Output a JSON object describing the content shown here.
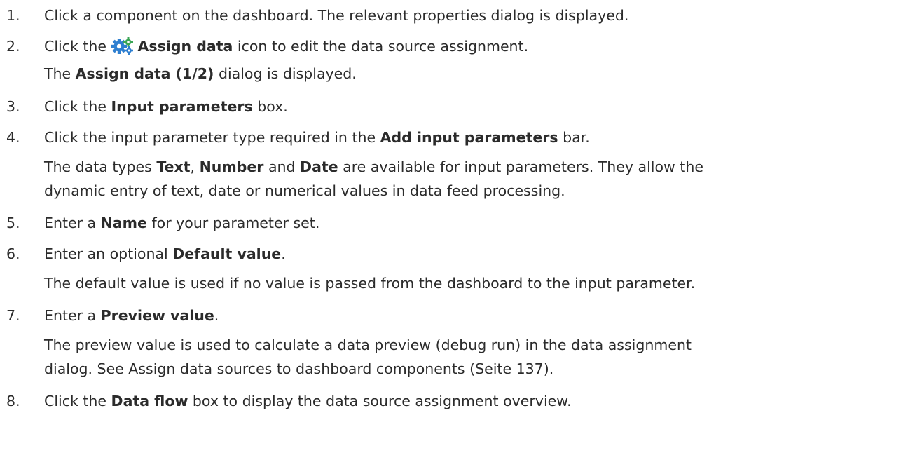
{
  "steps": [
    {
      "num": "1.",
      "text": "Click a component on the dashboard. The relevant properties dialog is displayed."
    },
    {
      "num": "2.",
      "pre": "Click the",
      "icon": "gear-icon",
      "bold": "Assign data",
      "post": "icon to edit the data source assignment.",
      "note": {
        "bold": "Assign data (1/2)",
        "post": "dialog is displayed.",
        "pre": "The"
      }
    },
    {
      "num": "3.",
      "pre": "Click the",
      "bold": "Input parameters",
      "post": "box."
    },
    {
      "num": "4.",
      "pre": "Click the input parameter type required in the",
      "bold": "Add input parameters",
      "post": "bar.",
      "note": {
        "pre": "The data types",
        "b1": "Text",
        "sep1": ",",
        "b2": "Number",
        "and": "and",
        "b3": "Date",
        "post": "are available for input parameters. They allow the",
        "line2": "dynamic entry of text, date or numerical values in data feed processing."
      }
    },
    {
      "num": "5.",
      "pre": "Enter a",
      "bold": "Name",
      "post": "for your parameter set."
    },
    {
      "num": "6.",
      "pre": "Enter an optional",
      "bold": "Default value",
      "post": ".",
      "note": {
        "text": "The default value is used if no value is passed from the dashboard to the input parameter."
      }
    },
    {
      "num": "7.",
      "pre": "Enter a",
      "bold": "Preview value",
      "post": ".",
      "note": {
        "line1": "The preview value is used to calculate a data preview (debug run) in the data assignment",
        "line2": "dialog. See Assign data sources to dashboard components (Seite 137)."
      }
    },
    {
      "num": "8.",
      "pre": "Click the",
      "bold": "Data flow",
      "post": "box to display the data source assignment overview."
    }
  ],
  "colors": {
    "text": "#2b2b2b",
    "gear_blue": "#2e7fd0",
    "gear_green": "#3aa655"
  }
}
